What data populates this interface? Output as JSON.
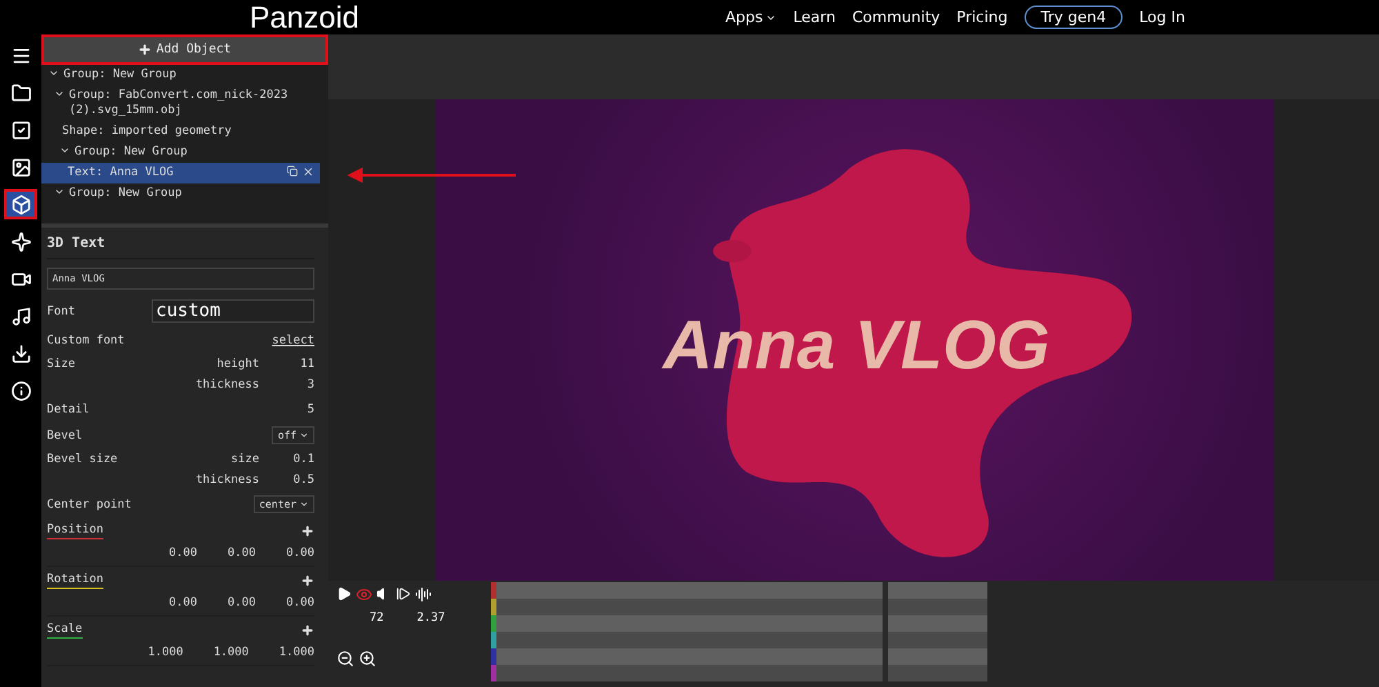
{
  "header": {
    "logo": "Panzoid",
    "nav": [
      {
        "label": "Apps",
        "kind": "dropdown"
      },
      {
        "label": "Learn",
        "kind": "link"
      },
      {
        "label": "Community",
        "kind": "link"
      },
      {
        "label": "Pricing",
        "kind": "link"
      },
      {
        "label": "Try gen4",
        "kind": "pill"
      },
      {
        "label": "Log In",
        "kind": "link"
      }
    ]
  },
  "rail": [
    {
      "kind": "menu",
      "selected": false
    },
    {
      "kind": "folder",
      "selected": false
    },
    {
      "kind": "checkbox",
      "selected": false
    },
    {
      "kind": "image",
      "selected": false
    },
    {
      "kind": "cube",
      "selected": true
    },
    {
      "kind": "burst",
      "selected": false
    },
    {
      "kind": "camera",
      "selected": false
    },
    {
      "kind": "music",
      "selected": false
    },
    {
      "kind": "download",
      "selected": false
    },
    {
      "kind": "info",
      "selected": false
    }
  ],
  "add_button": {
    "label": "Add Object",
    "highlighted": true
  },
  "tree": [
    {
      "label": "Group: New Group",
      "expanded": true,
      "selected": false,
      "children": [
        {
          "label": "Group: FabConvert.com_nick-2023 (2).svg_15mm.obj",
          "expanded": true,
          "selected": false,
          "children": [
            {
              "label": "Shape: imported geometry",
              "selected": false
            },
            {
              "label": "Group: New Group",
              "expanded": true,
              "selected": false,
              "children": [
                {
                  "label": "Text: Anna VLOG",
                  "selected": true
                }
              ]
            }
          ]
        },
        {
          "label": "Group: New Group",
          "expanded": true,
          "selected": false
        }
      ]
    }
  ],
  "properties": {
    "title": "3D Text",
    "name": "Anna VLOG",
    "rows": [
      {
        "kind": "input",
        "label": "Font",
        "value": "custom"
      },
      {
        "kind": "link",
        "label": "Custom font",
        "value": "select"
      },
      {
        "kind": "pairs",
        "label": "Size",
        "pairs": [
          {
            "label": "height",
            "value": "11"
          },
          {
            "label": "thickness",
            "value": "3"
          }
        ]
      },
      {
        "kind": "value",
        "label": "Detail",
        "value": "5"
      },
      {
        "kind": "select",
        "label": "Bevel",
        "value": "off"
      },
      {
        "kind": "pairs",
        "label": "Bevel size",
        "pairs": [
          {
            "label": "size",
            "value": "0.1"
          },
          {
            "label": "thickness",
            "value": "0.5"
          }
        ]
      },
      {
        "kind": "select",
        "label": "Center point",
        "value": "center"
      },
      {
        "kind": "vector",
        "label": "Position",
        "color": "#d0303a",
        "values": [
          "0.00",
          "0.00",
          "0.00"
        ]
      },
      {
        "kind": "vector",
        "label": "Rotation",
        "color": "#d8c020",
        "values": [
          "0.00",
          "0.00",
          "0.00"
        ]
      },
      {
        "kind": "vector",
        "label": "Scale",
        "color": "#30b040",
        "values": [
          "1.000",
          "1.000",
          "1.000"
        ]
      }
    ]
  },
  "viewport": {
    "text": "Anna VLOG"
  },
  "annotation": {
    "arrow": true
  },
  "timeline": {
    "eye_on": true,
    "frame": "72",
    "time": "2.37",
    "tracks": [
      {
        "color": "#b03030"
      },
      {
        "color": "#b0a030"
      },
      {
        "color": "#30a040"
      },
      {
        "color": "#30a0a0"
      },
      {
        "color": "#3030a0"
      },
      {
        "color": "#a030a0"
      }
    ]
  }
}
